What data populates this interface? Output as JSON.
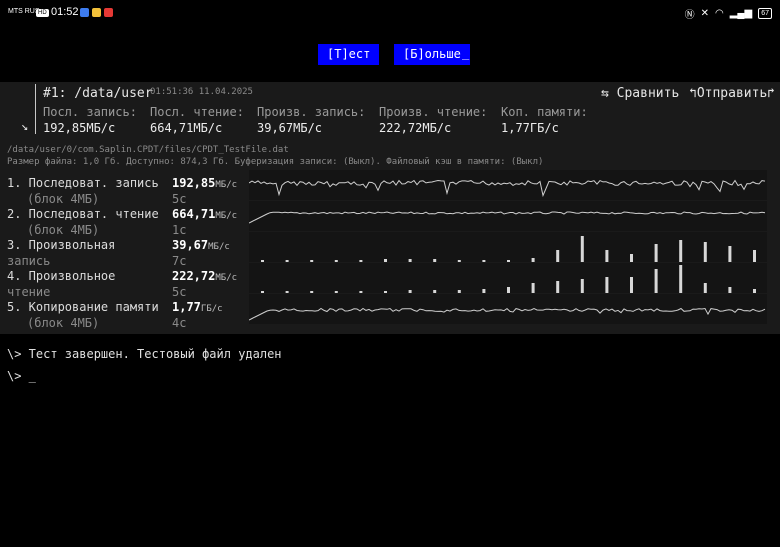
{
  "status_bar": {
    "carrier": "MTS RUS",
    "network_badge": "HD",
    "time": "01:52",
    "battery": "67"
  },
  "toolbar": {
    "test_button": "[Т]ест",
    "more_button": "[Б]ольше",
    "cursor": "_"
  },
  "result": {
    "title": "#1: /data/user",
    "timestamp": "01:51:36 11.04.2025",
    "compare_label": "⇆ Сравнить",
    "send_label": "↰Отправить↱",
    "expand_icon": "↘",
    "summary_headers": [
      "Посл. запись:",
      "Посл. чтение:",
      "Произв. запись:",
      "Произв. чтение:",
      "Коп. памяти:"
    ],
    "summary_values": [
      "192,85МБ/с",
      "664,71МБ/с",
      "39,67МБ/с",
      "222,72МБ/с",
      "1,77ГБ/с"
    ],
    "file_path": "/data/user/0/com.Saplin.CPDT/files/CPDT_TestFile.dat",
    "file_info": "Размер файла: 1,0 Гб. Доступно: 874,3 Гб. Буферизация записи: (Выкл). Файловый кэш в памяти: (Выкл)"
  },
  "tests": [
    {
      "line1": "1. Последоват. запись",
      "line2": "(блок 4МБ)",
      "value": "192,85",
      "unit": "МБ/с",
      "time": "5с"
    },
    {
      "line1": "2. Последоват. чтение",
      "line2": "(блок 4МБ)",
      "value": "664,71",
      "unit": "МБ/с",
      "time": "1с"
    },
    {
      "line1": "3. Произвольная",
      "line2": "запись",
      "value": "39,67",
      "unit": "МБ/с",
      "time": "7с"
    },
    {
      "line1": "4. Произвольное",
      "line2": "чтение",
      "value": "222,72",
      "unit": "МБ/с",
      "time": "5с"
    },
    {
      "line1": "5. Копирование памяти",
      "line2": "(блок 4МБ)",
      "value": "1,77",
      "unit": "ГБ/с",
      "time": "4с"
    }
  ],
  "terminal": {
    "line1": "\\> Тест завершен. Тестовый файл удален",
    "line2": "\\> _"
  }
}
